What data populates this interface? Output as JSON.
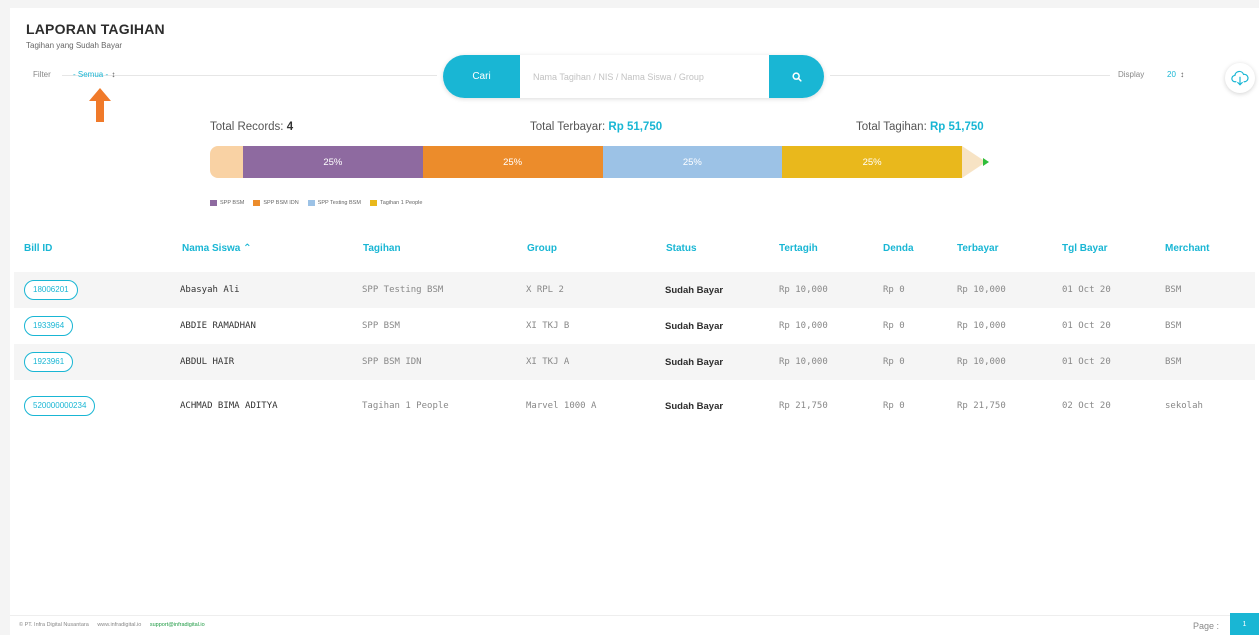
{
  "header": {
    "title": "LAPORAN TAGIHAN",
    "subtitle": "Tagihan yang Sudah Bayar"
  },
  "filter": {
    "label": "Filter",
    "value": "- Semua -",
    "caret": "↕"
  },
  "search": {
    "button_label": "Cari",
    "placeholder": "Nama Tagihan / NIS / Nama Siswa / Group",
    "icon": "search-icon"
  },
  "display": {
    "label": "Display",
    "value": "20",
    "caret": "↕"
  },
  "download_icon": "cloud-download-icon",
  "stats": {
    "total_records_label": "Total Records:",
    "total_records_value": "4",
    "total_terbayar_label": "Total Terbayar:",
    "total_terbayar_value": "Rp 51,750",
    "total_tagihan_label": "Total Tagihan:",
    "total_tagihan_value": "Rp 51,750"
  },
  "progress": {
    "segments": [
      {
        "label": "25%",
        "value": 25,
        "color": "#8e6aa0"
      },
      {
        "label": "25%",
        "value": 25,
        "color": "#ec8c2b"
      },
      {
        "label": "25%",
        "value": 25,
        "color": "#9cc2e6"
      },
      {
        "label": "25%",
        "value": 25,
        "color": "#e9b81c"
      }
    ]
  },
  "legend": [
    {
      "label": "SPP BSM",
      "color": "#8e6aa0"
    },
    {
      "label": "SPP BSM IDN",
      "color": "#ec8c2b"
    },
    {
      "label": "SPP Testing BSM",
      "color": "#9cc2e6"
    },
    {
      "label": "Tagihan 1 People",
      "color": "#e9b81c"
    }
  ],
  "table": {
    "headers": [
      "Bill ID",
      "Nama Siswa",
      "Tagihan",
      "Group",
      "Status",
      "Tertagih",
      "Denda",
      "Terbayar",
      "Tgl Bayar",
      "Merchant"
    ],
    "sort_indicator": "⌃",
    "rows": [
      {
        "bill_id": "18006201",
        "nama": "Abasyah Ali",
        "tagihan": "SPP Testing BSM",
        "group": "X RPL 2",
        "status": "Sudah Bayar",
        "tertagih": "Rp 10,000",
        "denda": "Rp 0",
        "terbayar": "Rp 10,000",
        "tgl": "01 Oct 20",
        "merchant": "BSM"
      },
      {
        "bill_id": "1933964",
        "nama": "ABDIE RAMADHAN",
        "tagihan": "SPP BSM",
        "group": "XI TKJ B",
        "status": "Sudah Bayar",
        "tertagih": "Rp 10,000",
        "denda": "Rp 0",
        "terbayar": "Rp 10,000",
        "tgl": "01 Oct 20",
        "merchant": "BSM"
      },
      {
        "bill_id": "1923961",
        "nama": "ABDUL HAIR",
        "tagihan": "SPP BSM IDN",
        "group": "XI TKJ A",
        "status": "Sudah Bayar",
        "tertagih": "Rp 10,000",
        "denda": "Rp 0",
        "terbayar": "Rp 10,000",
        "tgl": "01 Oct 20",
        "merchant": "BSM"
      },
      {
        "bill_id": "520000000234",
        "nama": "ACHMAD BIMA ADITYA",
        "tagihan": "Tagihan 1 People",
        "group": "Marvel 1000 A",
        "status": "Sudah Bayar",
        "tertagih": "Rp 21,750",
        "denda": "Rp 0",
        "terbayar": "Rp 21,750",
        "tgl": "02 Oct 20",
        "merchant": "sekolah"
      }
    ]
  },
  "footer": {
    "copyright": "© PT. Infra Digital Nusantara",
    "website": "www.infradigital.io",
    "email": "support@infradigital.io",
    "page_label": "Page :",
    "page_number": "1"
  }
}
